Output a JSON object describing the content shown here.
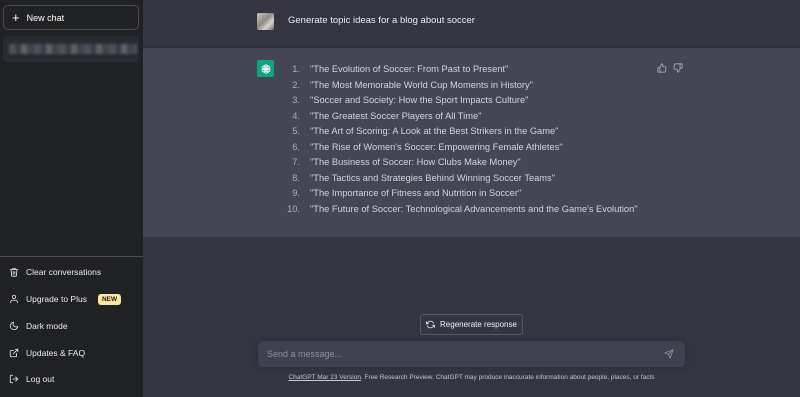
{
  "sidebar": {
    "new_chat_label": "New chat",
    "history_label": "",
    "items": [
      {
        "label": "Clear conversations",
        "icon": "trash-icon"
      },
      {
        "label": "Upgrade to Plus",
        "icon": "user-icon",
        "badge": "NEW"
      },
      {
        "label": "Dark mode",
        "icon": "moon-icon"
      },
      {
        "label": "Updates & FAQ",
        "icon": "external-link-icon"
      },
      {
        "label": "Log out",
        "icon": "logout-icon"
      }
    ]
  },
  "conversation": {
    "user_message": "Generate topic ideas for a blog about soccer",
    "assistant_items": [
      {
        "num": "1.",
        "text": "\"The Evolution of Soccer: From Past to Present\""
      },
      {
        "num": "2.",
        "text": "\"The Most Memorable World Cup Moments in History\""
      },
      {
        "num": "3.",
        "text": "\"Soccer and Society: How the Sport Impacts Culture\""
      },
      {
        "num": "4.",
        "text": "\"The Greatest Soccer Players of All Time\""
      },
      {
        "num": "5.",
        "text": "\"The Art of Scoring: A Look at the Best Strikers in the Game\""
      },
      {
        "num": "6.",
        "text": "\"The Rise of Women's Soccer: Empowering Female Athletes\""
      },
      {
        "num": "7.",
        "text": "\"The Business of Soccer: How Clubs Make Money\""
      },
      {
        "num": "8.",
        "text": "\"The Tactics and Strategies Behind Winning Soccer Teams\""
      },
      {
        "num": "9.",
        "text": "\"The Importance of Fitness and Nutrition in Soccer\""
      },
      {
        "num": "10.",
        "text": "\"The Future of Soccer: Technological Advancements and the Game's Evolution\""
      }
    ]
  },
  "composer": {
    "regenerate_label": "Regenerate response",
    "placeholder": "Send a message..."
  },
  "footer": {
    "version_link": "ChatGPT Mar 23 Version",
    "disclaimer": ". Free Research Preview. ChatGPT may produce inaccurate information about people, places, or facts"
  },
  "colors": {
    "sidebar_bg": "#202123",
    "main_bg": "#343541",
    "assistant_bg": "#444654",
    "accent": "#10a37f",
    "badge_bg": "#fae69e"
  }
}
